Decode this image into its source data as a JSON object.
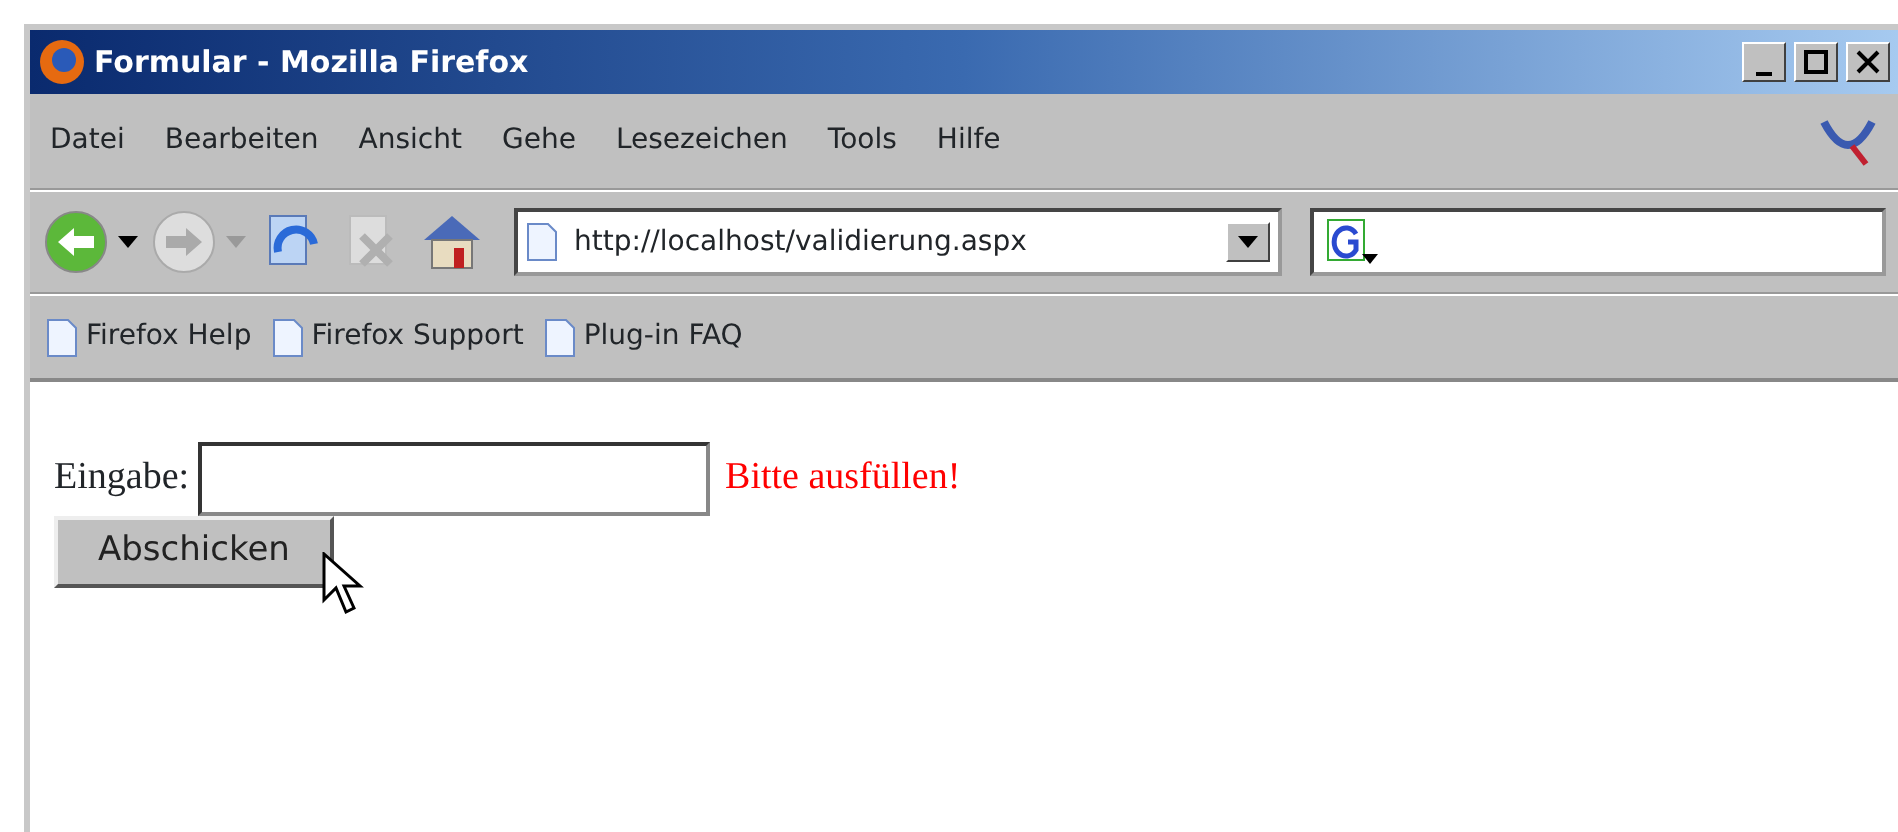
{
  "window": {
    "title": "Formular - Mozilla Firefox"
  },
  "menu": [
    "Datei",
    "Bearbeiten",
    "Ansicht",
    "Gehe",
    "Lesezeichen",
    "Tools",
    "Hilfe"
  ],
  "nav_buttons": [
    {
      "kind": "back",
      "disabled": false
    },
    {
      "kind": "forward",
      "disabled": true
    },
    {
      "kind": "reload",
      "disabled": false
    },
    {
      "kind": "stop",
      "disabled": true
    },
    {
      "kind": "home",
      "disabled": false
    }
  ],
  "address": "http://localhost/validierung.aspx",
  "bookmarks": [
    "Firefox Help",
    "Firefox Support",
    "Plug-in FAQ"
  ],
  "form": {
    "label": "Eingabe:",
    "error": "Bitte ausfüllen!",
    "button": "Abschicken"
  }
}
